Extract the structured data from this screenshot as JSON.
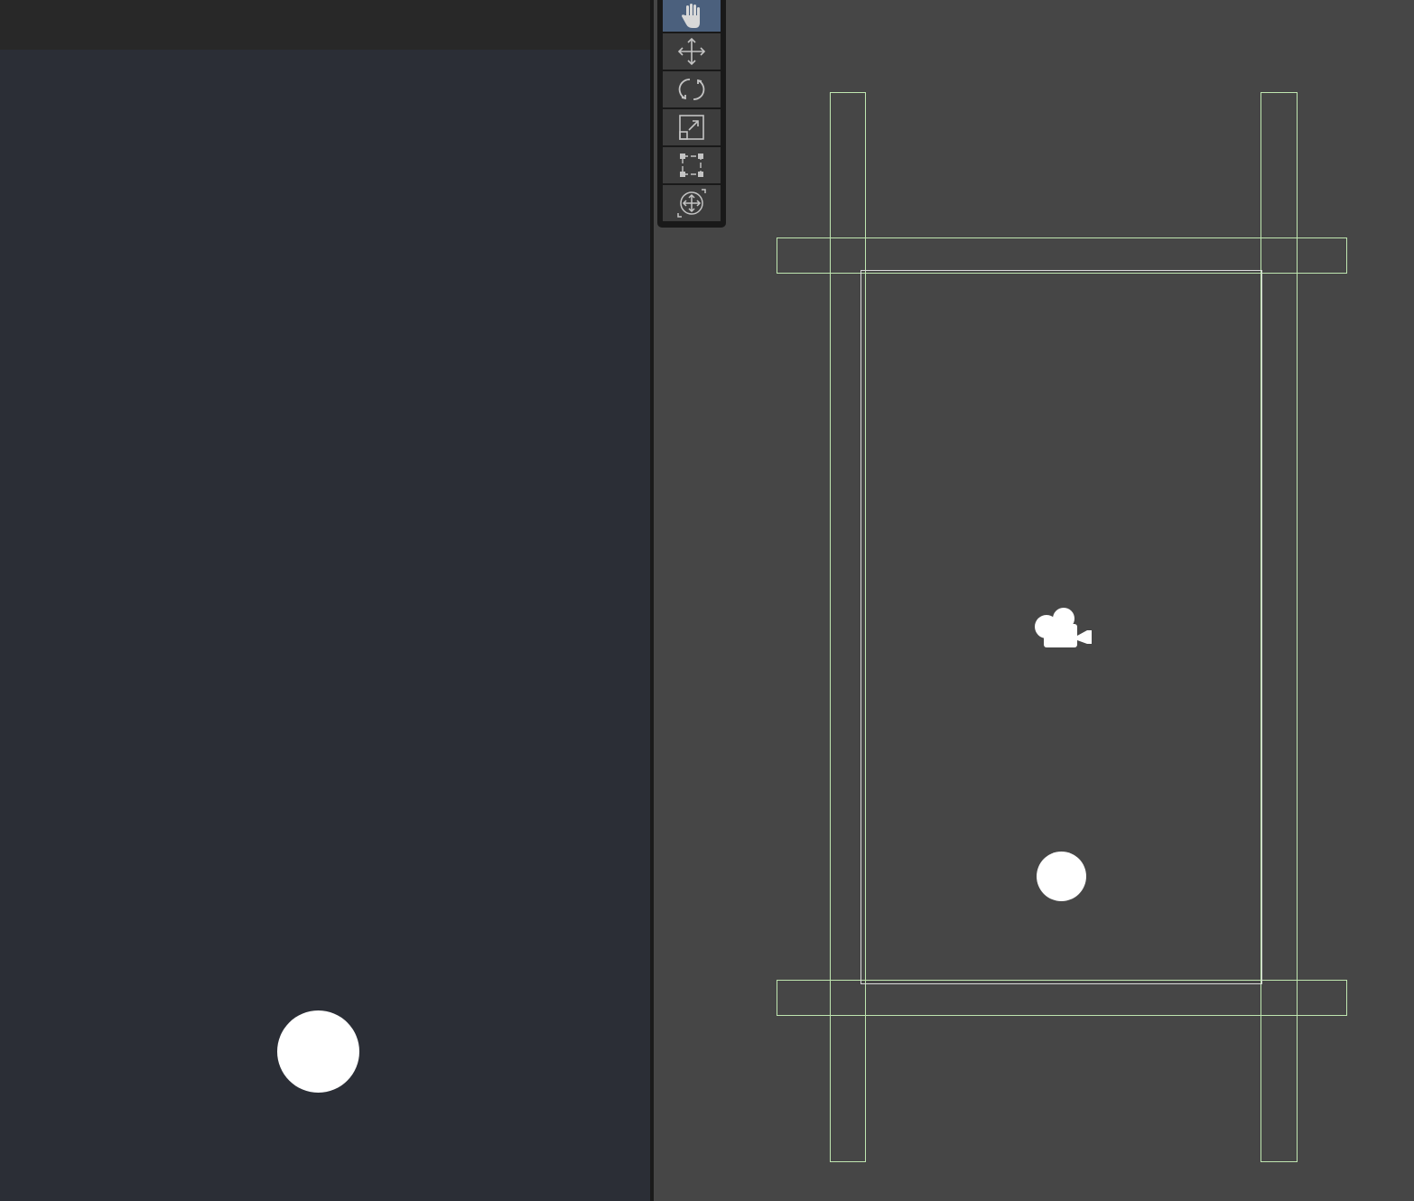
{
  "game_view": {
    "background_color": "#2b2e36",
    "toolbar_color": "#282828",
    "ball_color": "#ffffff"
  },
  "scene_view": {
    "background_color": "#464646",
    "outline_color": "#bfe6b0",
    "tools": [
      {
        "name": "view-tool",
        "icon": "hand-icon",
        "active": true
      },
      {
        "name": "move-tool",
        "icon": "move-arrows-icon",
        "active": false
      },
      {
        "name": "rotate-tool",
        "icon": "rotate-icon",
        "active": false
      },
      {
        "name": "scale-tool",
        "icon": "scale-icon",
        "active": false
      },
      {
        "name": "rect-tool",
        "icon": "rect-transform-icon",
        "active": false
      },
      {
        "name": "transform-tool",
        "icon": "transform-icon",
        "active": false
      }
    ],
    "gizmos": [
      {
        "name": "camera-gizmo",
        "icon": "camera-icon"
      }
    ]
  }
}
